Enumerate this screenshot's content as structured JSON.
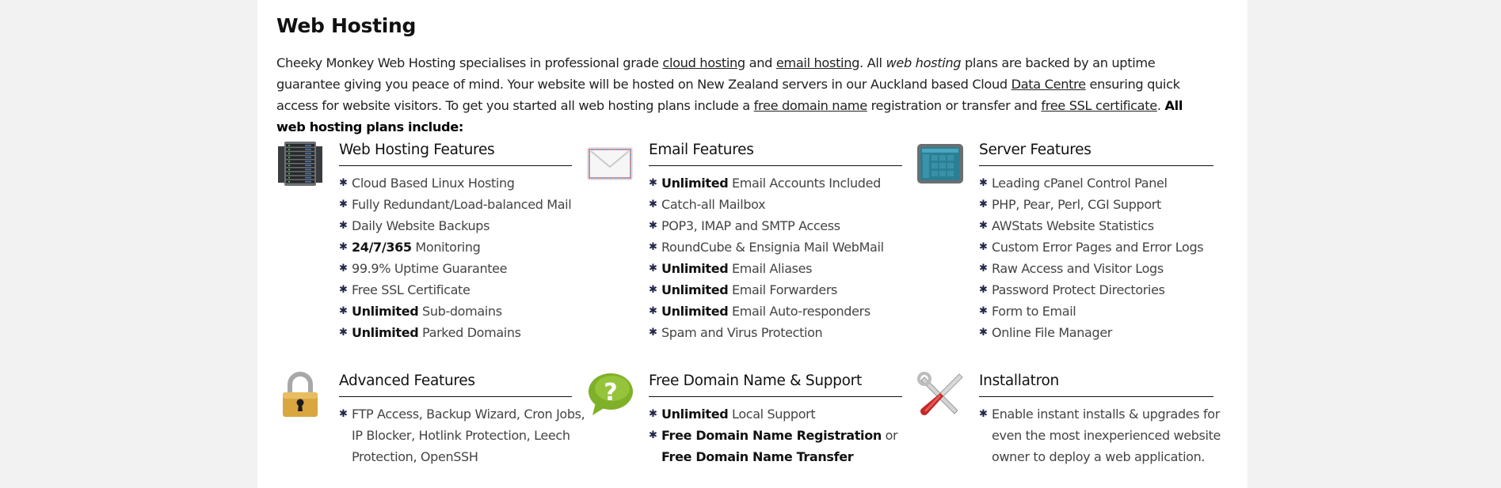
{
  "page": {
    "title": "Web Hosting",
    "intro": {
      "t1": "Cheeky Monkey Web Hosting specialises in professional grade ",
      "link_cloud": "cloud hosting",
      "t2": " and ",
      "link_email": "email hosting",
      "t3": ". All ",
      "em_web": "web hosting",
      "t4": " plans are backed by an uptime guarantee giving you peace of mind. Your website will be hosted on New Zealand servers in our Auckland based Cloud ",
      "link_datacentre": "Data Centre",
      "t5": " ensuring quick access for website visitors. To get you started all web hosting plans include a ",
      "link_domain": "free domain name",
      "t6": " registration or transfer and ",
      "link_ssl": "free SSL certificate",
      "t7": ". ",
      "strong_end": "All web hosting plans include:"
    }
  },
  "bullet_glyph": "✱",
  "features": {
    "web": {
      "icon": "server-rack-icon",
      "title": "Web Hosting Features",
      "items": [
        {
          "bold": "",
          "text": "Cloud Based Linux Hosting"
        },
        {
          "bold": "",
          "text": "Fully Redundant/Load-balanced Mail"
        },
        {
          "bold": "",
          "text": "Daily Website Backups"
        },
        {
          "bold": "24/7/365",
          "text": " Monitoring"
        },
        {
          "bold": "",
          "text": "99.9% Uptime Guarantee"
        },
        {
          "bold": "",
          "text": "Free SSL Certificate"
        },
        {
          "bold": "Unlimited",
          "text": " Sub-domains"
        },
        {
          "bold": "Unlimited",
          "text": " Parked Domains"
        }
      ]
    },
    "email": {
      "icon": "envelope-icon",
      "title": "Email Features",
      "items": [
        {
          "bold": "Unlimited",
          "text": " Email Accounts Included"
        },
        {
          "bold": "",
          "text": "Catch-all Mailbox"
        },
        {
          "bold": "",
          "text": "POP3, IMAP and SMTP Access"
        },
        {
          "bold": "",
          "text": "RoundCube & Ensignia Mail WebMail"
        },
        {
          "bold": "Unlimited",
          "text": " Email Aliases"
        },
        {
          "bold": "Unlimited",
          "text": " Email Forwarders"
        },
        {
          "bold": "Unlimited",
          "text": " Email Auto-responders"
        },
        {
          "bold": "",
          "text": "Spam and Virus Protection"
        }
      ]
    },
    "server": {
      "icon": "control-panel-icon",
      "title": "Server Features",
      "items": [
        {
          "bold": "",
          "text": "Leading cPanel Control Panel"
        },
        {
          "bold": "",
          "text": "PHP, Pear, Perl, CGI Support"
        },
        {
          "bold": "",
          "text": "AWStats Website Statistics"
        },
        {
          "bold": "",
          "text": "Custom Error Pages and Error Logs"
        },
        {
          "bold": "",
          "text": "Raw Access and Visitor Logs"
        },
        {
          "bold": "",
          "text": "Password Protect Directories"
        },
        {
          "bold": "",
          "text": "Form to Email"
        },
        {
          "bold": "",
          "text": "Online File Manager"
        }
      ]
    },
    "advanced": {
      "icon": "padlock-icon",
      "title": "Advanced Features",
      "items": [
        {
          "bold": "",
          "text": "FTP Access, Backup Wizard, Cron Jobs, IP Blocker, Hotlink Protection, Leech Protection, OpenSSH"
        }
      ]
    },
    "support": {
      "icon": "help-bubble-icon",
      "title": "Free Domain Name & Support",
      "items": [
        {
          "bold": "Unlimited",
          "text": " Local Support"
        },
        {
          "bold": "Free Domain Name Registration",
          "text": " or ",
          "bold2": "Free Domain Name Transfer"
        }
      ]
    },
    "installatron": {
      "icon": "tools-icon",
      "title": "Installatron",
      "items": [
        {
          "bold": "",
          "text": "Enable instant installs & upgrades for even the most inexperienced website owner to deploy a web application."
        }
      ]
    }
  }
}
